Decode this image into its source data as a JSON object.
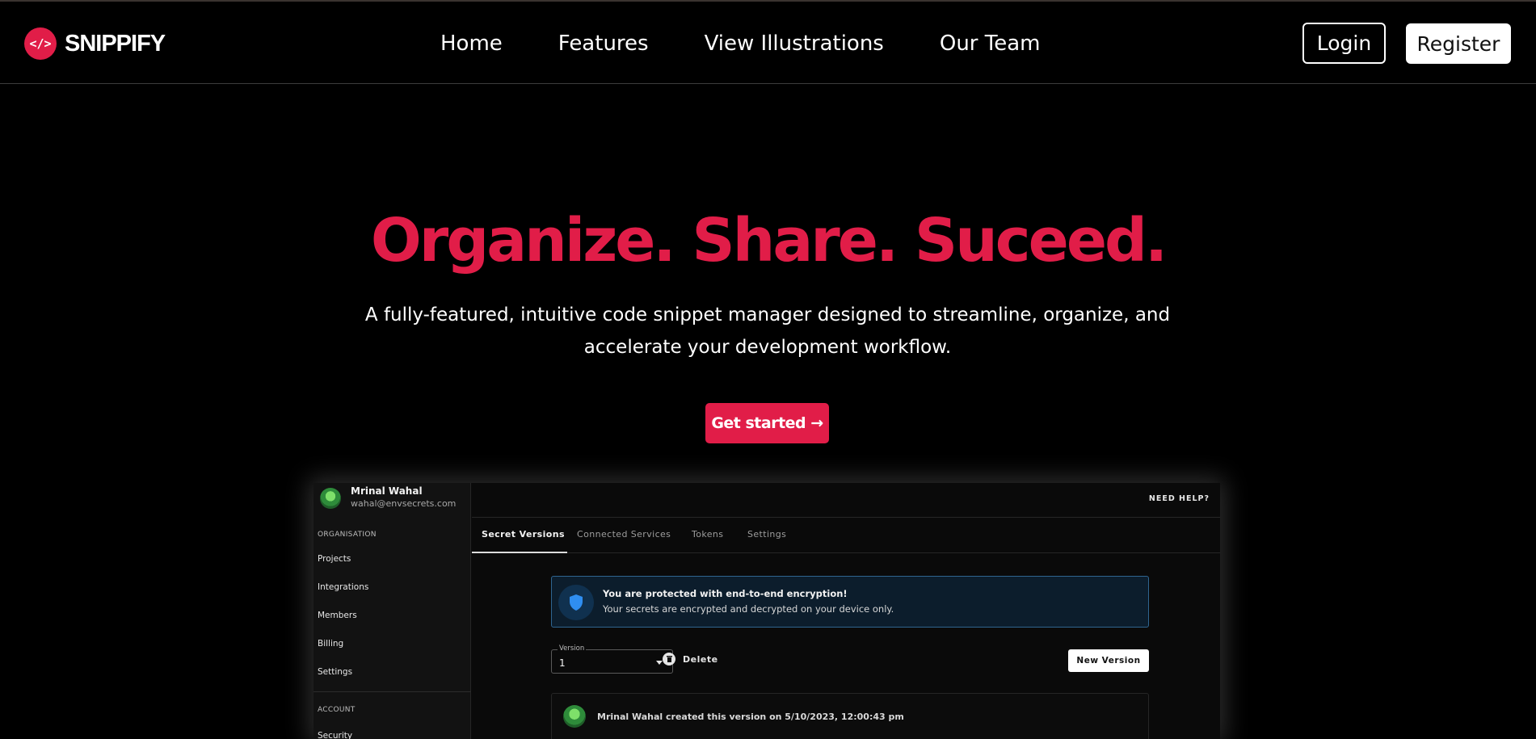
{
  "brand": {
    "logo_glyph": "</>",
    "name": "SNIPPIFY",
    "accent": "#e11d48"
  },
  "nav": {
    "links": [
      {
        "label": "Home"
      },
      {
        "label": "Features"
      },
      {
        "label": "View Illustrations"
      },
      {
        "label": "Our Team"
      }
    ],
    "login": "Login",
    "register": "Register"
  },
  "hero": {
    "title": "Organize. Share. Suceed.",
    "subtitle": "A fully-featured, intuitive code snippet manager designed to streamline, organize, and accelerate your development workflow.",
    "cta": "Get started →"
  },
  "preview": {
    "user": {
      "name": "Mrinal Wahal",
      "email": "wahal@envsecrets.com"
    },
    "sidebar": {
      "organisation_heading": "ORGANISATION",
      "items": [
        "Projects",
        "Integrations",
        "Members",
        "Billing",
        "Settings"
      ],
      "account_heading": "ACCOUNT",
      "account_items": [
        "Security"
      ]
    },
    "help": "NEED HELP?",
    "tabs": [
      "Secret Versions",
      "Connected Services",
      "Tokens",
      "Settings"
    ],
    "notice": {
      "icon": "shield-icon",
      "title": "You are protected with end-to-end encryption!",
      "text": "Your secrets are encrypted and decrypted on your device only."
    },
    "version": {
      "label": "Version",
      "value": "1"
    },
    "delete": "Delete",
    "new_version": "New Version",
    "activity": "Mrinal Wahal created this version on 5/10/2023, 12:00:43 pm"
  }
}
